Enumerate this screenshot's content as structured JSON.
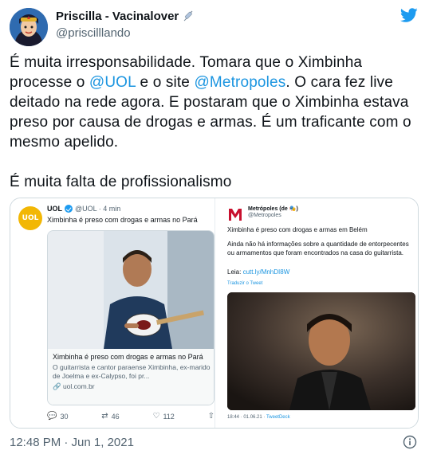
{
  "author": {
    "display_name": "Priscilla - Vacinalover",
    "handle": "@priscilllando",
    "emoji_icon": "syringe-icon"
  },
  "tweet": {
    "text_part1": "É muita irresponsabilidade. Tomara que o Ximbinha processe o ",
    "mention1": "@UOL",
    "text_part2": " e o site ",
    "mention2": "@Metropoles",
    "text_part3": ". O cara fez live deitado na rede agora. E postaram que o Ximbinha estava preso por causa de drogas e armas. É um traficante com o mesmo apelido.\n\nÉ muita falta de profissionalismo",
    "timestamp": "12:48 PM · Jun 1, 2021"
  },
  "uol_embed": {
    "logo_text": "UOL",
    "name": "UOL",
    "handle_time": "@UOL · 4 min",
    "headline": "Ximbinha é preso com drogas e armas no Pará",
    "card_title": "Ximbinha é preso com drogas e armas no Pará",
    "card_desc": "O guitarrista e cantor paraense Ximbinha, ex-marido de Joelma e ex-Calypso, foi pr...",
    "card_link": "uol.com.br",
    "replies": "30",
    "retweets": "46",
    "likes": "112"
  },
  "metro_embed": {
    "name": "Metrópoles (de 🎭)",
    "handle": "@Metropoles",
    "text1": "Ximbinha é preso com drogas e armas em Belém",
    "text2": "Ainda não há informações sobre a quantidade de entorpecentes ou armamentos que foram encontrados na casa do guitarrista.",
    "leia_label": "Leia: ",
    "leia_link": "cutt.ly/MnhDI8W",
    "translate": "Traduzir o Tweet",
    "footer_time": "18:44 · 01.06.21 · ",
    "footer_client": "TweetDeck"
  },
  "colors": {
    "link": "#1b95e0",
    "secondary": "#536471",
    "twitter_blue": "#1d9bf0",
    "uol_yellow": "#f2b705",
    "metro_red": "#c8102e"
  }
}
